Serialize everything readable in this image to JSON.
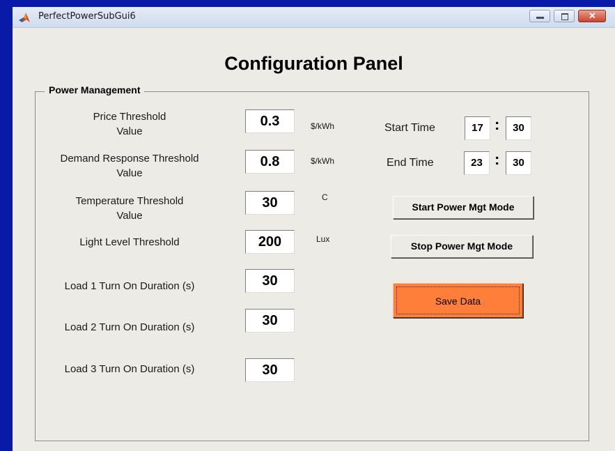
{
  "window": {
    "title": "PerfectPowerSubGui6",
    "icon": "matlab-logo-icon"
  },
  "panel": {
    "title": "Configuration Panel"
  },
  "group": {
    "title": "Power Management",
    "fields": [
      {
        "label_line1": "Price Threshold",
        "label_line2": "Value",
        "value": "0.3",
        "unit": "$/kWh"
      },
      {
        "label_line1": "Demand Response Threshold",
        "label_line2": "Value",
        "value": "0.8",
        "unit": "$/kWh"
      },
      {
        "label_line1": "Temperature Threshold",
        "label_line2": "Value",
        "value": "30",
        "unit": "C"
      },
      {
        "label_line1": "Light Level Threshold",
        "value": "200",
        "unit": "Lux"
      },
      {
        "label_line1": "Load 1 Turn On Duration (s)",
        "value": "30"
      },
      {
        "label_line1": "Load 2 Turn On Duration (s)",
        "value": "30"
      },
      {
        "label_line1": "Load 3 Turn On Duration (s)",
        "value": "30"
      }
    ],
    "start_time": {
      "label": "Start Time",
      "hour": "17",
      "minute": "30",
      "separator": ":"
    },
    "end_time": {
      "label": "End Time",
      "hour": "23",
      "minute": "30",
      "separator": ":"
    },
    "buttons": {
      "start_mode": "Start Power Mgt Mode",
      "stop_mode": "Stop Power Mgt Mode",
      "save": "Save Data"
    }
  },
  "colors": {
    "save_button": "#ff7f3a",
    "background": "#0a1aa8",
    "window": "#ecebe6"
  }
}
